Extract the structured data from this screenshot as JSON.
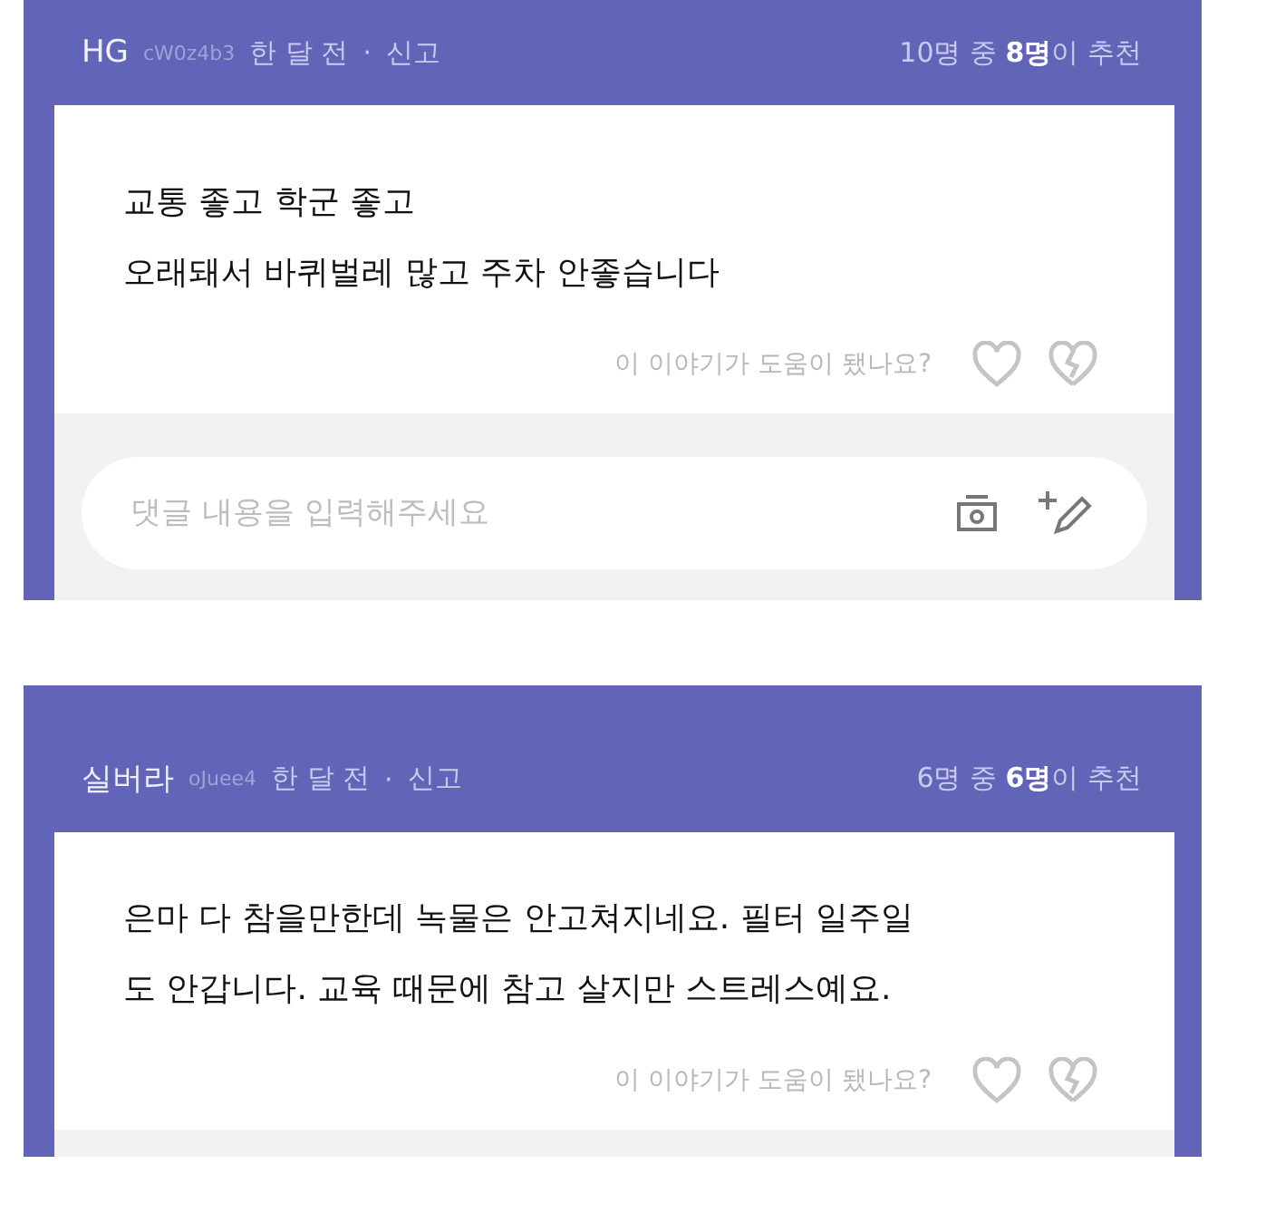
{
  "reviews": [
    {
      "author": "HG",
      "user_id": "cW0z4b3",
      "time": "한 달 전",
      "separator": "·",
      "report": "신고",
      "recommend": "10명 중 **8명**이 추천",
      "lines": [
        "교통 좋고 학군 좋고",
        "오래돼서 바퀴벌레 많고 주차 안좋습니다"
      ],
      "helpful_prompt": "이 이야기가 도움이 됐나요?",
      "comment": {
        "placeholder": "댓글 내용을 입력해주세요"
      }
    },
    {
      "author": "실버라",
      "user_id": "oJuee4",
      "time": "한 달 전",
      "separator": "·",
      "report": "신고",
      "recommend": "6명 중 **6명**이 추천",
      "lines": [
        "은마 다 참을만한데 녹물은 안고쳐지네요. 필터 일주일",
        "도 안갑니다. 교육 때문에 참고 살지만 스트레스예요."
      ],
      "helpful_prompt": "이 이야기가 도움이 됐나요?"
    }
  ]
}
